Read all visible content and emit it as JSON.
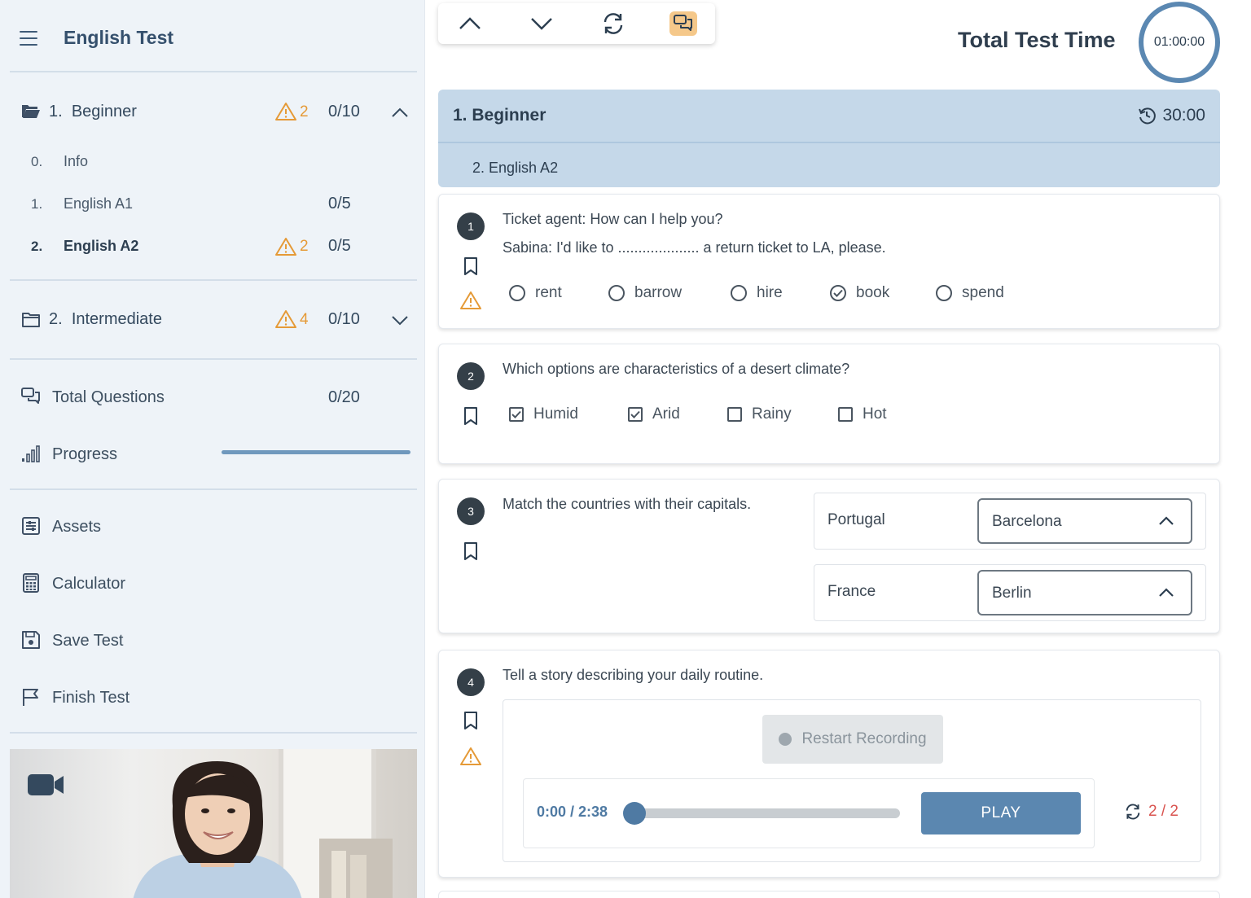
{
  "app": {
    "title": "English Test"
  },
  "sections": [
    {
      "num": "1.",
      "label": "Beginner",
      "warnings": "2",
      "score": "0/10",
      "expanded": true,
      "items": [
        {
          "num": "0.",
          "label": "Info",
          "warnings": "",
          "score": ""
        },
        {
          "num": "1.",
          "label": "English A1",
          "warnings": "",
          "score": "0/5"
        },
        {
          "num": "2.",
          "label": "English A2",
          "warnings": "2",
          "score": "0/5",
          "active": true
        }
      ]
    },
    {
      "num": "2.",
      "label": "Intermediate",
      "warnings": "4",
      "score": "0/10",
      "expanded": false
    }
  ],
  "stats": {
    "total_questions_label": "Total Questions",
    "total_questions_value": "0/20",
    "progress_label": "Progress",
    "progress_fraction": 1.0
  },
  "tools": {
    "assets": "Assets",
    "calculator": "Calculator",
    "save_test": "Save Test",
    "finish_test": "Finish Test"
  },
  "header": {
    "total_time_label": "Total Test Time",
    "total_time_value": "01:00:00"
  },
  "current_section": {
    "title": "1. Beginner",
    "time": "30:00",
    "subtitle": "2.  English A2"
  },
  "questions": [
    {
      "number": "1",
      "line1": "Ticket agent: How can I help you?",
      "line2": "Sabina: I'd like to .................... a return ticket to LA, please.",
      "options": [
        "rent",
        "barrow",
        "hire",
        "book",
        "spend"
      ],
      "selected": "book"
    },
    {
      "number": "2",
      "text": "Which options are characteristics of a desert climate?",
      "options": [
        "Humid",
        "Arid",
        "Rainy",
        "Hot"
      ],
      "checked": [
        "Humid",
        "Arid"
      ]
    },
    {
      "number": "3",
      "text": "Match the countries with their capitals.",
      "pairs": [
        {
          "country": "Portugal",
          "selected": "Barcelona"
        },
        {
          "country": "France",
          "selected": "Berlin"
        }
      ]
    },
    {
      "number": "4",
      "text": "Tell a story describing your daily routine.",
      "restart_label": "Restart Recording",
      "player_time": "0:00 / 2:38",
      "play_label": "PLAY",
      "attempts": "2 / 2"
    }
  ],
  "colors": {
    "accent": "#5b87b0",
    "warning": "#e59a37",
    "highlight": "#f5c88a",
    "header_bg": "#c5d8e9",
    "sidebar_bg": "#eef3f8",
    "attempts": "#d9534f"
  },
  "icons": {
    "menu": "hamburger-icon",
    "folder_open": "folder-open-icon",
    "folder": "folder-icon",
    "warning": "warning-icon",
    "chevron_up": "chevron-up-icon",
    "chevron_down": "chevron-down-icon",
    "questions": "chat-bubbles-icon",
    "progress": "signal-bars-icon",
    "assets": "list-box-icon",
    "calculator": "calculator-icon",
    "save": "floppy-disk-icon",
    "finish": "flag-icon",
    "video": "video-camera-icon",
    "refresh": "refresh-icon",
    "history": "history-icon",
    "bookmark": "bookmark-icon"
  }
}
